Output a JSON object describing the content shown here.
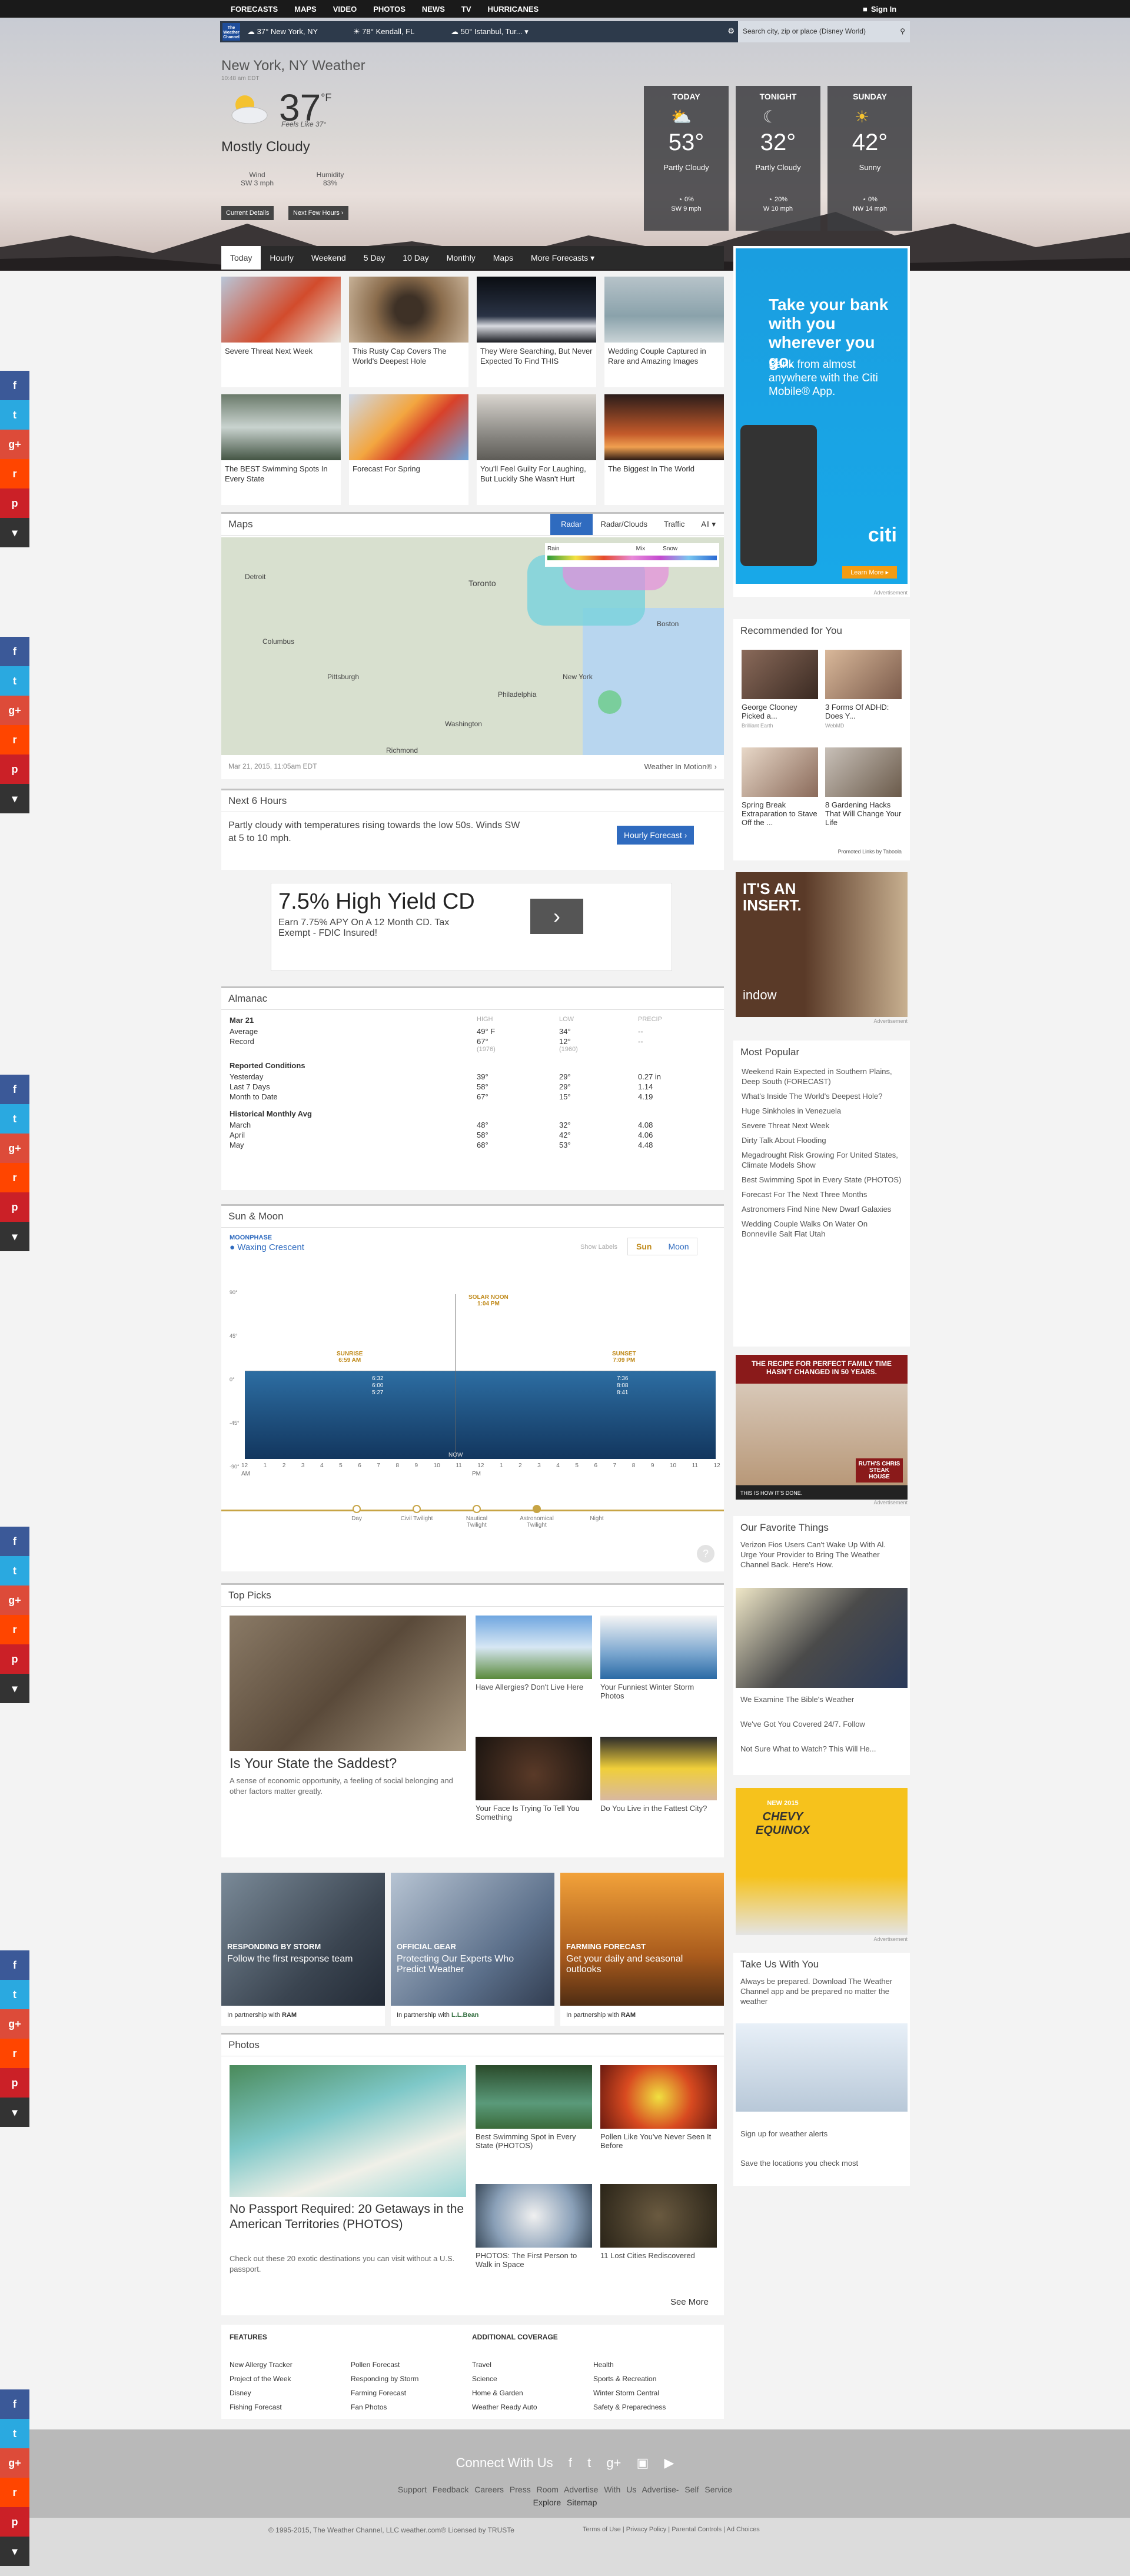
{
  "topnav": {
    "items": [
      "FORECASTS",
      "MAPS",
      "VIDEO",
      "PHOTOS",
      "NEWS",
      "TV",
      "HURRICANES"
    ],
    "signin": "Sign In"
  },
  "locbar": {
    "logo": "The Weather Channel",
    "locations": [
      {
        "temp": "37°",
        "name": "New York, NY"
      },
      {
        "temp": "78°",
        "name": "Kendall, FL"
      },
      {
        "temp": "50°",
        "name": "Istanbul, Tur..."
      }
    ],
    "search_placeholder": "Search city, zip or place (Disney World)"
  },
  "current": {
    "location": "New York, NY Weather",
    "time": "10:48 am EDT",
    "temp": "37",
    "unit": "°F",
    "feels": "Feels Like 37°",
    "condition": "Mostly Cloudy",
    "wind_label": "Wind",
    "wind": "SW 3 mph",
    "humidity_label": "Humidity",
    "humidity": "83%",
    "btn_details": "Current Details",
    "btn_hours": "Next Few Hours"
  },
  "forecast": [
    {
      "day": "TODAY",
      "temp": "53°",
      "cond": "Partly Cloudy",
      "precip": "0%",
      "wind": "SW 9 mph"
    },
    {
      "day": "TONIGHT",
      "temp": "32°",
      "cond": "Partly Cloudy",
      "precip": "20%",
      "wind": "W 10 mph"
    },
    {
      "day": "SUNDAY",
      "temp": "42°",
      "cond": "Sunny",
      "precip": "0%",
      "wind": "NW 14 mph"
    }
  ],
  "tabs": [
    "Today",
    "Hourly",
    "Weekend",
    "5 Day",
    "10 Day",
    "Monthly",
    "Maps",
    "More Forecasts"
  ],
  "cards": [
    "Severe Threat Next Week",
    "This Rusty Cap Covers The World's Deepest Hole",
    "They Were Searching, But Never Expected To Find THIS",
    "Wedding Couple Captured in Rare and Amazing Images",
    "The BEST Swimming Spots In Every State",
    "Forecast For Spring",
    "You'll Feel Guilty For Laughing, But Luckily She Wasn't Hurt",
    "The Biggest In The World"
  ],
  "maps": {
    "title": "Maps",
    "tabs": [
      "Radar",
      "Radar/Clouds",
      "Traffic",
      "All"
    ],
    "legend": [
      "Rain",
      "Mix",
      "Snow"
    ],
    "date": "Mar 21, 2015, 11:05am EDT",
    "link": "Weather In Motion®",
    "cities": [
      "Toronto",
      "Boston",
      "New York",
      "Pittsburgh",
      "Philadelphia",
      "Washington",
      "Richmond",
      "Columbus",
      "Detroit"
    ]
  },
  "next6": {
    "title": "Next 6 Hours",
    "text": "Partly cloudy with temperatures rising towards the low 50s. Winds SW at 5 to 10 mph.",
    "button": "Hourly Forecast"
  },
  "ad1": {
    "headline": "7.5% High Yield CD",
    "text": "Earn 7.75% APY On A 12 Month CD. Tax Exempt - FDIC Insured!"
  },
  "almanac": {
    "title": "Almanac",
    "date": "Mar 21",
    "headers": [
      "HIGH",
      "LOW",
      "PRECIP"
    ],
    "avg": [
      "Average",
      "49° F",
      "34°",
      "--"
    ],
    "record": [
      "Record",
      "67°",
      "12°",
      "--"
    ],
    "record_years": [
      "(1976)",
      "(1960)"
    ],
    "reported_title": "Reported Conditions",
    "reported": [
      [
        "Yesterday",
        "39°",
        "29°",
        "0.27 in"
      ],
      [
        "Last 7 Days",
        "58°",
        "29°",
        "1.14"
      ],
      [
        "Month to Date",
        "67°",
        "15°",
        "4.19"
      ]
    ],
    "hist_title": "Historical Monthly Avg",
    "hist": [
      [
        "March",
        "48°",
        "32°",
        "4.08"
      ],
      [
        "April",
        "58°",
        "42°",
        "4.06"
      ],
      [
        "May",
        "68°",
        "53°",
        "4.48"
      ]
    ]
  },
  "sunmoon": {
    "title": "Sun & Moon",
    "moonphase_label": "MOONPHASE",
    "moonphase": "Waxing Crescent",
    "show_labels": "Show Labels",
    "tab_sun": "Sun",
    "tab_moon": "Moon",
    "noon": "SOLAR NOON",
    "noon_time": "1:04 PM",
    "sunrise": "SUNRISE",
    "sunrise_time": "6:59 AM",
    "sunset": "SUNSET",
    "sunset_time": "7:09 PM",
    "now": "NOW",
    "yaxis": [
      "90°",
      "45°",
      "0°",
      "-45°",
      "-90°"
    ],
    "xaxis": [
      "12",
      "1",
      "2",
      "3",
      "4",
      "5",
      "6",
      "7",
      "8",
      "9",
      "10",
      "11",
      "12",
      "1",
      "2",
      "3",
      "4",
      "5",
      "6",
      "7",
      "8",
      "9",
      "10",
      "11",
      "12"
    ],
    "am": "AM",
    "pm": "PM",
    "left_times": [
      "6:32",
      "6:00",
      "5:27"
    ],
    "right_times": [
      "7:36",
      "8:08",
      "8:41"
    ],
    "phases": [
      "Day",
      "Civil Twilight",
      "Nautical Twilight",
      "Astronomical Twilight",
      "Night"
    ]
  },
  "toppicks": {
    "title": "Top Picks",
    "main": "Is Your State the Saddest?",
    "main_desc": "A sense of economic opportunity, a feeling of social belonging and other factors matter greatly.",
    "items": [
      "Have Allergies? Don't Live Here",
      "Your Funniest Winter Storm Photos",
      "Your Face Is Trying To Tell You Something",
      "Do You Live in the Fattest City?"
    ]
  },
  "promos": [
    {
      "kicker": "RESPONDING BY STORM",
      "text": "Follow the first response team",
      "partner": "In partnership with",
      "brand": "RAM"
    },
    {
      "kicker": "OFFICIAL GEAR",
      "text": "Protecting Our Experts Who Predict Weather",
      "partner": "In partnership with",
      "brand": "L.L.Bean"
    },
    {
      "kicker": "FARMING FORECAST",
      "text": "Get your daily and seasonal outlooks",
      "partner": "In partnership with",
      "brand": "RAM"
    }
  ],
  "photos": {
    "title": "Photos",
    "main": "No Passport Required: 20 Getaways in the American Territories (PHOTOS)",
    "main_desc": "Check out these 20 exotic destinations you can visit without a U.S. passport.",
    "items": [
      "Best Swimming Spot in Every State (PHOTOS)",
      "Pollen Like You've Never Seen It Before",
      "PHOTOS: The First Person to Walk in Space",
      "11 Lost Cities Rediscovered"
    ],
    "more": "See More"
  },
  "footer_links": {
    "features_title": "FEATURES",
    "coverage_title": "ADDITIONAL COVERAGE",
    "col1": [
      "New Allergy Tracker",
      "Project of the Week",
      "Disney",
      "Fishing Forecast"
    ],
    "col2": [
      "Pollen Forecast",
      "Responding by Storm",
      "Farming Forecast",
      "Fan Photos"
    ],
    "col3": [
      "Travel",
      "Science",
      "Home & Garden",
      "Weather Ready Auto"
    ],
    "col4": [
      "Health",
      "Sports & Recreation",
      "Winter Storm Central",
      "Safety & Preparedness"
    ]
  },
  "footer": {
    "connect": "Connect With Us",
    "links": [
      "Support",
      "Feedback",
      "Careers",
      "Press Room",
      "Advertise With Us",
      "Advertise- Self Service"
    ],
    "links2": [
      "Explore",
      "Sitemap"
    ],
    "copyright": "© 1995-2015, The Weather Channel, LLC weather.com® Licensed by TRUSTe",
    "legal": "Terms of Use | Privacy Policy | Parental Controls | Ad Choices"
  },
  "side_ad1": {
    "headline": "Take your bank with you wherever you go.",
    "text": "Bank from almost anywhere with the Citi Mobile® App.",
    "brand": "citi",
    "btn": "Learn More",
    "label": "Advertisement"
  },
  "recommended": {
    "title": "Recommended for You",
    "items": [
      {
        "t": "George Clooney Picked a...",
        "s": "Brilliant Earth"
      },
      {
        "t": "3 Forms Of ADHD: Does Y...",
        "s": "WebMD"
      },
      {
        "t": "Spring Break Extraparation to Stave Off the ...",
        "s": ""
      },
      {
        "t": "8 Gardening Hacks That Will Change Your Life",
        "s": ""
      }
    ],
    "footer": "Promoted Links by Taboola"
  },
  "side_ad2": {
    "headline": "IT'S AN INSERT.",
    "brand": "indow",
    "label": "Advertisement"
  },
  "popular": {
    "title": "Most Popular",
    "items": [
      "Weekend Rain Expected in Southern Plains, Deep South (FORECAST)",
      "What's Inside The World's Deepest Hole?",
      "Huge Sinkholes in Venezuela",
      "Severe Threat Next Week",
      "Dirty Talk About Flooding",
      "Megadrought Risk Growing For United States, Climate Models Show",
      "Best Swimming Spot in Every State (PHOTOS)",
      "Forecast For The Next Three Months",
      "Astronomers Find Nine New Dwarf Galaxies",
      "Wedding Couple Walks On Water On Bonneville Salt Flat Utah"
    ]
  },
  "side_ad3": {
    "headline": "THE RECIPE FOR PERFECT FAMILY TIME HASN'T CHANGED IN 50 YEARS.",
    "brand": "RUTH'S CHRIS STEAK HOUSE",
    "footer": "THIS IS HOW IT'S DONE.",
    "label": "Advertisement"
  },
  "favorites": {
    "title": "Our Favorite Things",
    "intro": "Verizon Fios Users Can't Wake Up With Al. Urge Your Provider to Bring The Weather Channel Back. Here's How.",
    "items": [
      "We Examine The Bible's Weather",
      "We've Got You Covered 24/7. Follow",
      "Not Sure What to Watch? This Will He..."
    ]
  },
  "side_ad4": {
    "kicker": "NEW 2015",
    "headline": "CHEVY EQUINOX",
    "label": "Advertisement"
  },
  "takeus": {
    "title": "Take Us With You",
    "text": "Always be prepared. Download The Weather Channel app and be prepared no matter the weather",
    "links": [
      "Sign up for weather alerts",
      "Save the locations you check most"
    ]
  },
  "colors": {
    "accent": "#2f6bbf",
    "nav": "#1a1a1a",
    "facebook": "#3b5998",
    "twitter": "#2aa9e0",
    "gplus": "#dd4b39",
    "reddit": "#ff4500",
    "pinterest": "#cb2027",
    "more": "#333333"
  },
  "social_icons": [
    "f",
    "t",
    "g+",
    "r",
    "p",
    "▾"
  ]
}
